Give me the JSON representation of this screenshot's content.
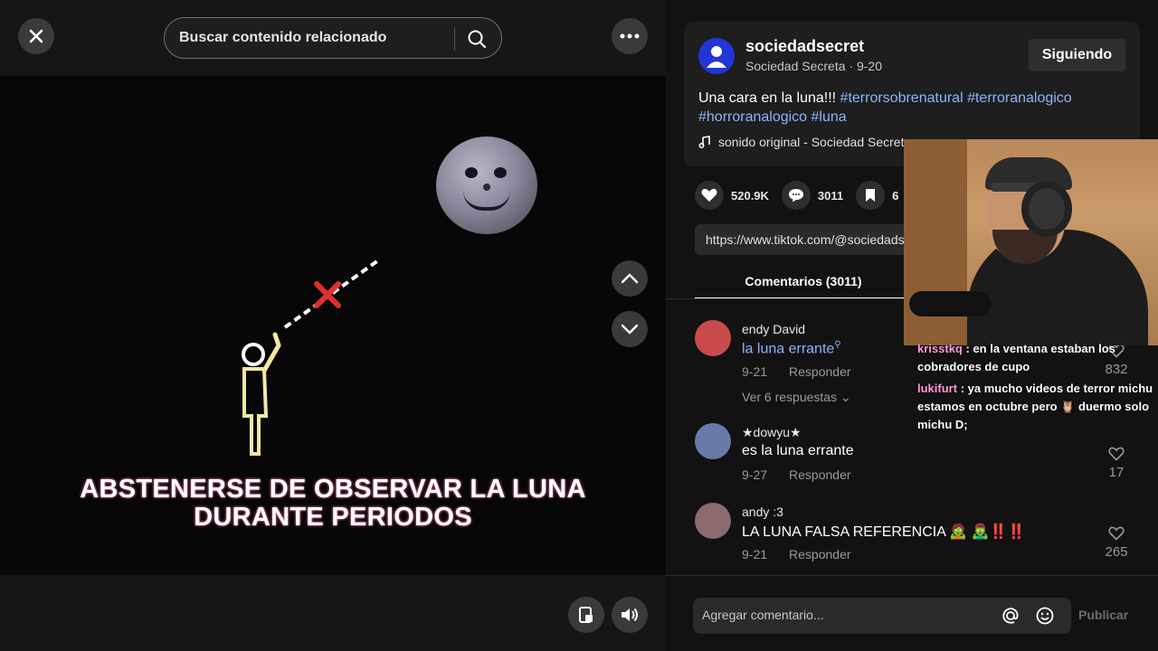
{
  "header": {
    "search_placeholder": "Buscar contenido relacionado",
    "icons": {
      "close": "close-icon",
      "search": "search-icon",
      "more": "more-icon"
    }
  },
  "video": {
    "caption_line1": "ABSTENERSE DE OBSERVAR LA LUNA",
    "caption_line2": "DURANTE PERIODOS"
  },
  "post": {
    "username": "sociedadsecret",
    "display_name": "Sociedad Secreta",
    "date": "9-20",
    "follow_label": "Siguiendo",
    "description_text": "Una cara en la luna!!! ",
    "hashtags": [
      "#terrorsobrenatural",
      "#terroranalogico",
      "#horroranalogico",
      "#luna"
    ],
    "music": "sonido original - Sociedad Secreta"
  },
  "stats": {
    "likes": "520.9K",
    "comments": "3011",
    "saves": "6"
  },
  "share_link": "https://www.tiktok.com/@sociedadsecret",
  "tabs": {
    "comments_label": "Comentarios (3011)"
  },
  "comments": [
    {
      "user": "endy David",
      "text": "la luna errante",
      "date": "9-21",
      "reply": "Responder",
      "more": "Ver 6 respuestas",
      "likes": "832",
      "avatar_color": "#c94a4a"
    },
    {
      "user": "★dowyu★",
      "text": "es la luna errante",
      "date": "9-27",
      "reply": "Responder",
      "likes": "17",
      "avatar_color": "#6a7aa8"
    },
    {
      "user": "andy :3",
      "text": "LA LUNA FALSA REFERENCIA 🧟 🧟‍♂️‼️‼️",
      "date": "9-21",
      "reply": "Responder",
      "likes": "265",
      "avatar_color": "#8a6a6a"
    }
  ],
  "composer": {
    "placeholder": "Agregar comentario...",
    "publish_label": "Publicar"
  },
  "stream_chat": [
    {
      "user": "krisstkq",
      "text": ": en la ventana estaban los cobradores de cupo"
    },
    {
      "user": "lukifurt",
      "text": ": ya mucho videos de terror michu estamos en octubre pero 🦉 duermo solo michu D;"
    }
  ]
}
